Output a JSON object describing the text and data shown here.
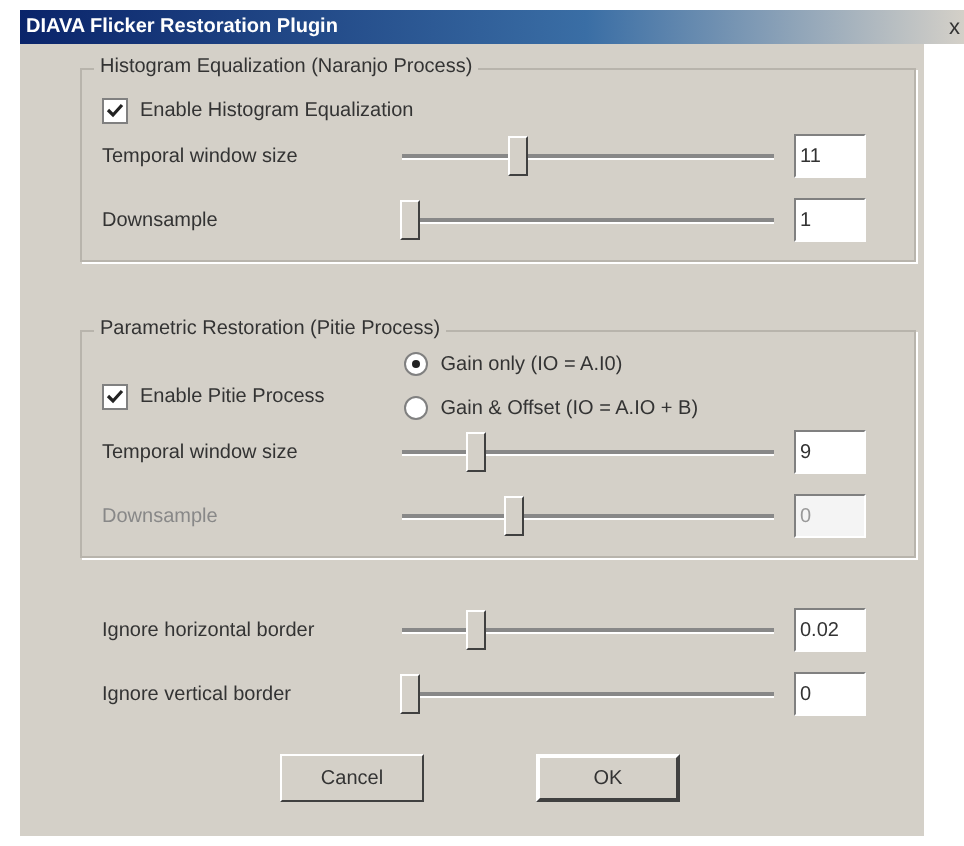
{
  "window": {
    "title": "DIAVA Flicker Restoration Plugin",
    "close": "x"
  },
  "histogram": {
    "title": "Histogram Equalization (Naranjo Process)",
    "enable": {
      "label": "Enable Histogram Equalization",
      "checked": true
    },
    "rows": [
      {
        "label": "Temporal window size",
        "level": 0.31,
        "value": "11",
        "disabled": false
      },
      {
        "label": "Downsample",
        "level": 0.02,
        "value": "1",
        "disabled": false
      }
    ]
  },
  "parametric": {
    "title": "Parametric Restoration (Pitie Process)",
    "enable": {
      "label": "Enable Pitie Process",
      "checked": true
    },
    "modes": [
      {
        "label": "Gain only (IO = A.I0)",
        "selected": true
      },
      {
        "label": "Gain & Offset (IO = A.IO + B)",
        "selected": false
      }
    ],
    "rows": [
      {
        "label": "Temporal window size",
        "level": 0.2,
        "value": "9",
        "disabled": false
      },
      {
        "label": "Downsample",
        "level": 0.3,
        "value": "0",
        "disabled": true
      }
    ]
  },
  "borders": [
    {
      "label": "Ignore horizontal border",
      "level": 0.2,
      "value": "0.02",
      "disabled": false
    },
    {
      "label": "Ignore vertical border",
      "level": 0.02,
      "value": "0",
      "disabled": false
    }
  ],
  "buttons": [
    {
      "label": "Cancel",
      "default": false
    },
    {
      "label": "OK",
      "default": true
    }
  ]
}
